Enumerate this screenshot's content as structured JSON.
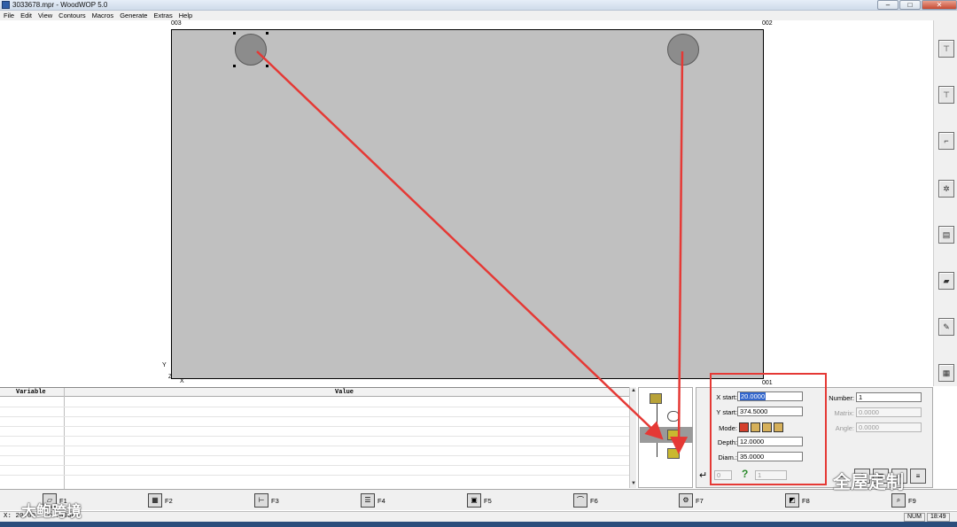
{
  "window": {
    "title": "3033678.mpr - WoodWOP 5.0",
    "buttons": [
      "–",
      "□",
      "✕"
    ]
  },
  "menu": [
    "File",
    "Edit",
    "View",
    "Contours",
    "Macros",
    "Generate",
    "Extras",
    "Help"
  ],
  "drawing": {
    "corner_labels": {
      "top_left": "003",
      "top_right": "002",
      "bottom_right": "001"
    },
    "axis_y": "Y",
    "axis_x": "X",
    "axis_origin": "Z"
  },
  "variables_table": {
    "columns": [
      "Variable",
      "Value"
    ]
  },
  "parameters": {
    "x_start_label": "X start:",
    "x_start_value": "20.0000",
    "y_start_label": "Y start:",
    "y_start_value": "374.5000",
    "mode_label": "Mode:",
    "depth_label": "Depth:",
    "depth_value": "12.0000",
    "diam_label": "Diam.:",
    "diam_value": "35.0000",
    "number_label": "Number:",
    "number_value": "1",
    "matrix_label": "Matrix:",
    "matrix_value": "0.0000",
    "angle_label": "Angle:",
    "angle_value": "0.0000",
    "bottom_left_value": "0",
    "bottom_right_value": "1",
    "help_icon": "?"
  },
  "function_keys": [
    "F1",
    "F2",
    "F3",
    "F4",
    "F5",
    "F6",
    "F7",
    "F8",
    "F9"
  ],
  "status": {
    "coords": "X: 20.00 - 96.0000",
    "num": "NUM",
    "time": "18:49"
  },
  "watermark": {
    "left": "大鲍跨境",
    "right": "全屋定制"
  },
  "colors": {
    "panel": "#c0c0c0",
    "arrow": "#e53935",
    "highlight": "#e53935",
    "selection": "#3366cc"
  }
}
